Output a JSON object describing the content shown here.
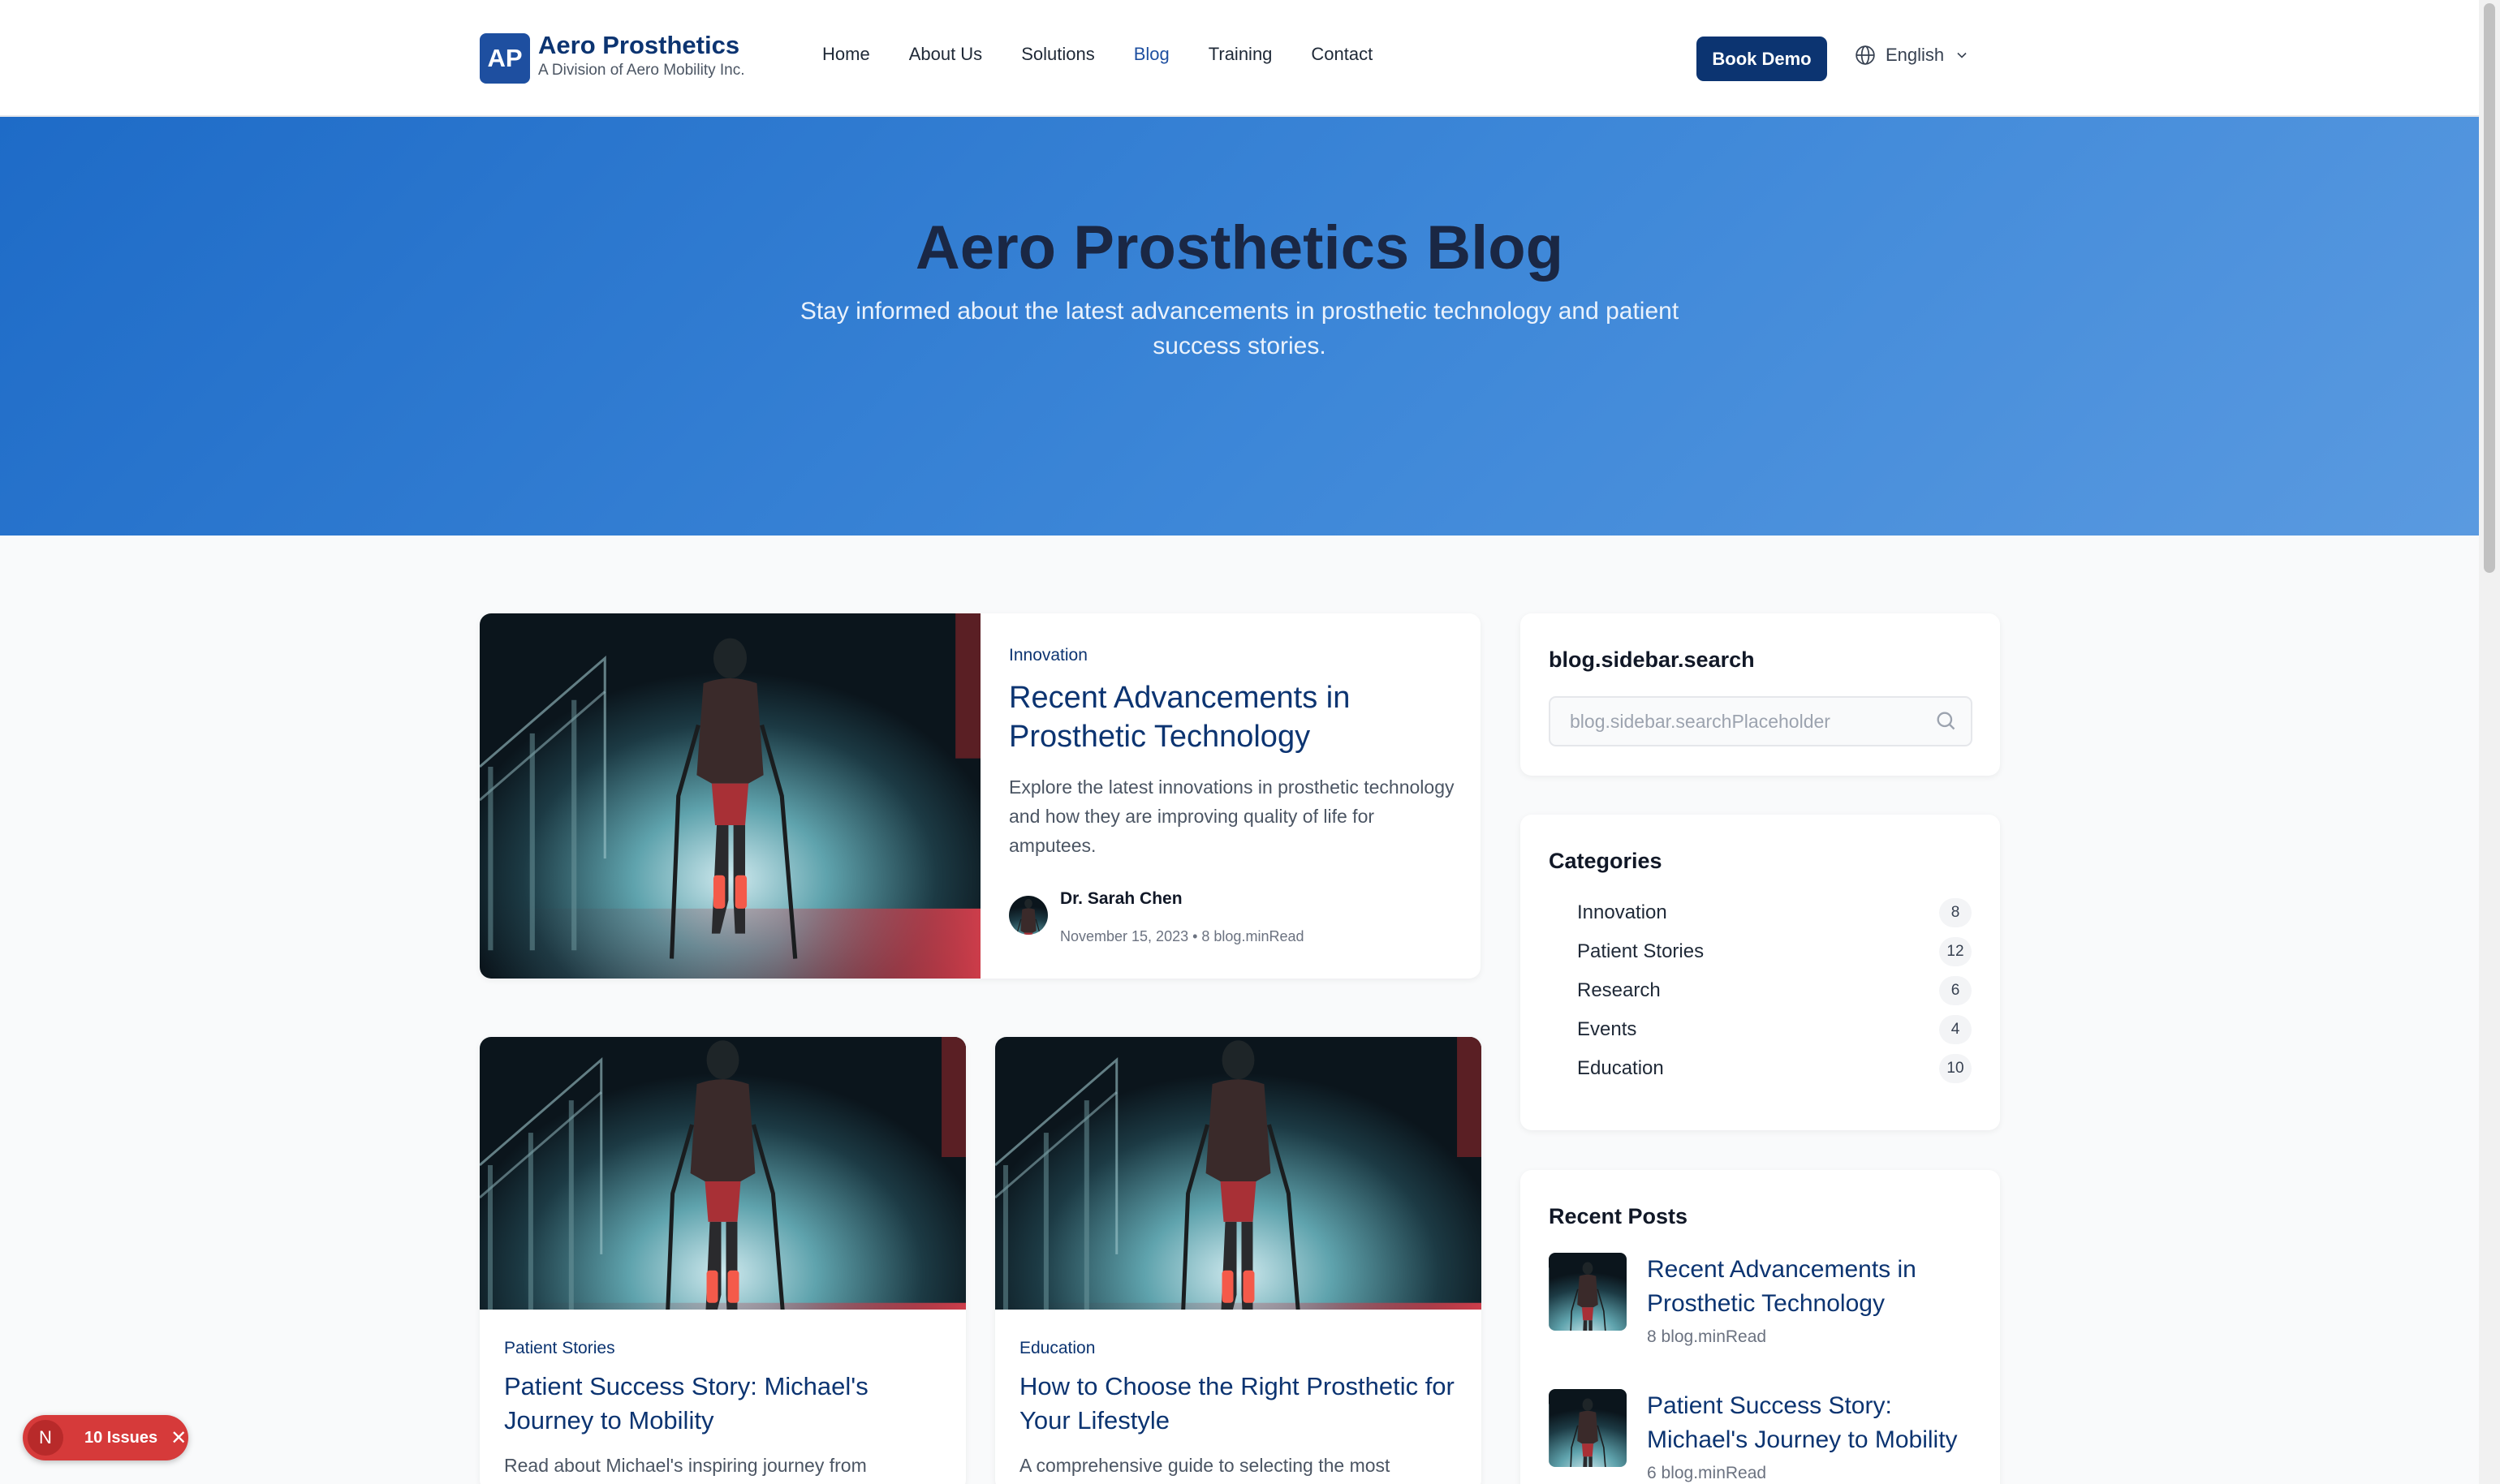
{
  "header": {
    "logo_mark": "AP",
    "logo_title": "Aero Prosthetics",
    "logo_subtitle": "A Division of Aero Mobility Inc.",
    "nav": [
      "Home",
      "About Us",
      "Solutions",
      "Blog",
      "Training",
      "Contact"
    ],
    "active_nav": "Blog",
    "book_demo": "Book Demo",
    "language": "English",
    "language_icon": "globe-icon",
    "language_dropdown_icon": "chevron-down-icon"
  },
  "hero": {
    "title": "Aero Prosthetics Blog",
    "subtitle": "Stay informed about the latest advancements in prosthetic technology and patient success stories."
  },
  "featured": {
    "category": "Innovation",
    "title": "Recent Advancements in Prosthetic Technology",
    "excerpt": "Explore the latest innovations in prosthetic technology and how they are improving quality of life for amputees.",
    "author": "Dr. Sarah Chen",
    "meta": "November 15, 2023 • 8 blog.minRead"
  },
  "posts": [
    {
      "category": "Patient Stories",
      "title": "Patient Success Story: Michael's Journey to Mobility",
      "excerpt": "Read about Michael's inspiring journey from"
    },
    {
      "category": "Education",
      "title": "How to Choose the Right Prosthetic for Your Lifestyle",
      "excerpt": "A comprehensive guide to selecting the most"
    }
  ],
  "sidebar": {
    "search_title": "blog.sidebar.search",
    "search_placeholder": "blog.sidebar.searchPlaceholder",
    "search_icon": "search-icon",
    "categories_title": "Categories",
    "categories": [
      {
        "name": "Innovation",
        "count": "8"
      },
      {
        "name": "Patient Stories",
        "count": "12"
      },
      {
        "name": "Research",
        "count": "6"
      },
      {
        "name": "Events",
        "count": "4"
      },
      {
        "name": "Education",
        "count": "10"
      }
    ],
    "recent_title": "Recent Posts",
    "recent": [
      {
        "title": "Recent Advancements in Prosthetic Technology",
        "meta": "8 blog.minRead"
      },
      {
        "title": "Patient Success Story: Michael's Journey to Mobility",
        "meta": "6 blog.minRead"
      }
    ]
  },
  "issues_badge": {
    "avatar": "N",
    "label": "10 Issues",
    "close": "✕"
  },
  "colors": {
    "brand_dark": "#0c3471",
    "brand": "#1e4fa0",
    "hero_start": "#1e6bc7",
    "hero_end": "#5a9ae0",
    "issues_red": "#d63a3a"
  }
}
